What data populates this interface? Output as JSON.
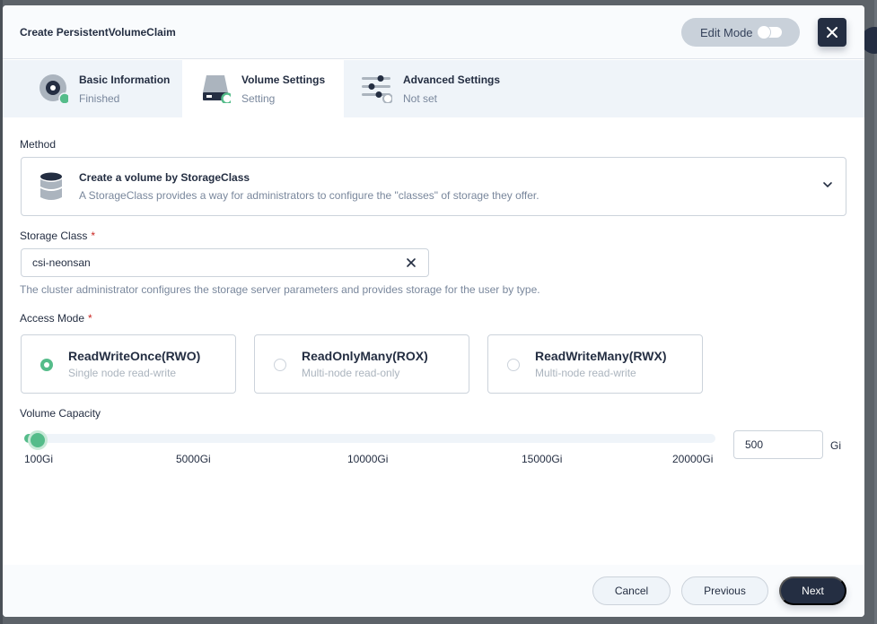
{
  "dialog": {
    "title": "Create PersistentVolumeClaim",
    "edit_mode_label": "Edit Mode"
  },
  "steps": [
    {
      "name": "Basic Information",
      "status": "Finished"
    },
    {
      "name": "Volume Settings",
      "status": "Setting"
    },
    {
      "name": "Advanced Settings",
      "status": "Not set"
    }
  ],
  "method": {
    "label": "Method",
    "title": "Create a volume by StorageClass",
    "description": "A StorageClass provides a way for administrators to configure the \"classes\" of storage they offer."
  },
  "storage_class": {
    "label": "Storage Class",
    "required_mark": "*",
    "value": "csi-neonsan",
    "description": "The cluster administrator configures the storage server parameters and provides storage for the user by type."
  },
  "access_mode": {
    "label": "Access Mode",
    "required_mark": "*",
    "selected": "ReadWriteOnce(RWO)",
    "options": [
      {
        "title": "ReadWriteOnce(RWO)",
        "desc": "Single node read-write"
      },
      {
        "title": "ReadOnlyMany(ROX)",
        "desc": "Multi-node read-only"
      },
      {
        "title": "ReadWriteMany(RWX)",
        "desc": "Multi-node read-write"
      }
    ]
  },
  "capacity": {
    "label": "Volume Capacity",
    "value": "500",
    "unit": "Gi",
    "ticks": [
      "100Gi",
      "5000Gi",
      "10000Gi",
      "15000Gi",
      "20000Gi"
    ],
    "slider_fraction": 0.02
  },
  "footer": {
    "cancel": "Cancel",
    "previous": "Previous",
    "next": "Next"
  },
  "colors": {
    "accent": "#55bc8a",
    "dark": "#242e42"
  }
}
